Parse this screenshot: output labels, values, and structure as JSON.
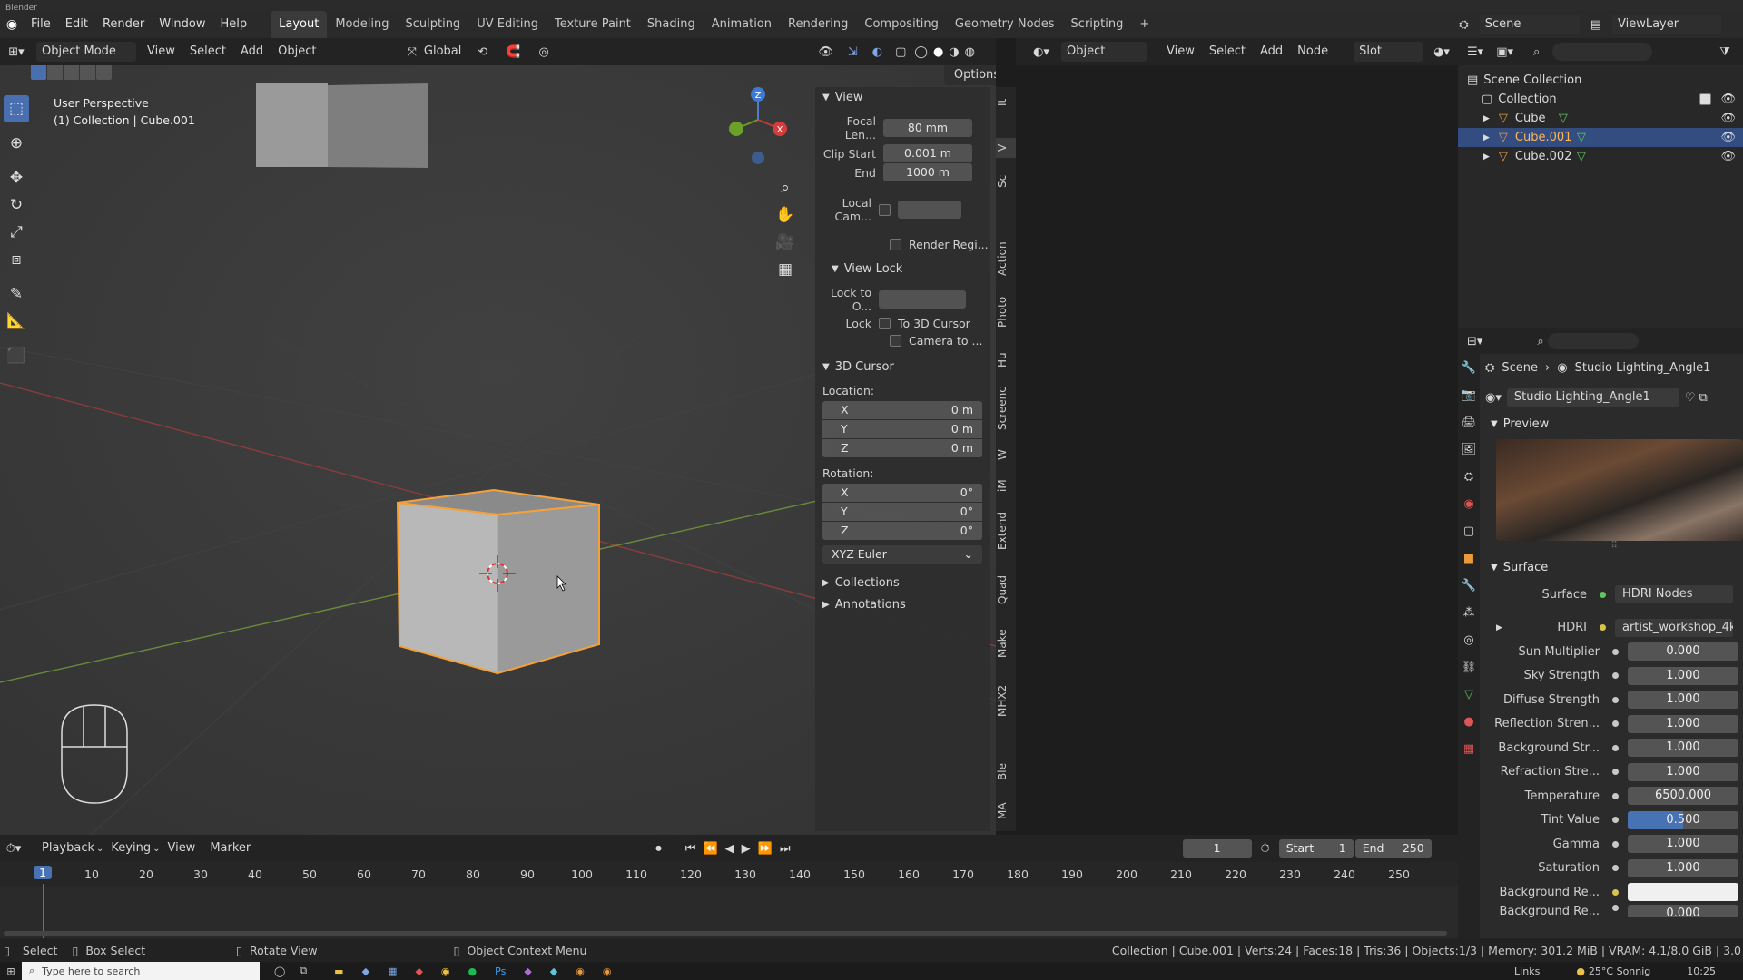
{
  "app": {
    "title": "Blender"
  },
  "menus": [
    "File",
    "Edit",
    "Render",
    "Window",
    "Help"
  ],
  "workspaces": [
    "Layout",
    "Modeling",
    "Sculpting",
    "UV Editing",
    "Texture Paint",
    "Shading",
    "Animation",
    "Rendering",
    "Compositing",
    "Geometry Nodes",
    "Scripting"
  ],
  "topright": {
    "scene": "Scene",
    "view_layer": "ViewLayer"
  },
  "vp_header": {
    "mode": "Object Mode",
    "view": "View",
    "select": "Select",
    "add": "Add",
    "object": "Object",
    "orientation": "Global",
    "options": "Options"
  },
  "viewport": {
    "perspective": "User Perspective",
    "collection": "(1) Collection | Cube.001"
  },
  "npanel": {
    "view_title": "View",
    "focal_label": "Focal Len...",
    "focal_value": "80 mm",
    "clip_start_label": "Clip Start",
    "clip_start_value": "0.001 m",
    "end_label": "End",
    "end_value": "1000 m",
    "local_cam_label": "Local Cam...",
    "render_region": "Render Regi...",
    "view_lock_title": "View Lock",
    "lock_to_label": "Lock to O...",
    "lock_label": "Lock",
    "to_3d_cursor": "To 3D Cursor",
    "camera_to": "Camera to ...",
    "cursor_title": "3D Cursor",
    "location_label": "Location:",
    "loc": [
      {
        "axis": "X",
        "value": "0 m"
      },
      {
        "axis": "Y",
        "value": "0 m"
      },
      {
        "axis": "Z",
        "value": "0 m"
      }
    ],
    "rotation_label": "Rotation:",
    "rot": [
      {
        "axis": "X",
        "value": "0°"
      },
      {
        "axis": "Y",
        "value": "0°"
      },
      {
        "axis": "Z",
        "value": "0°"
      }
    ],
    "rotation_mode": "XYZ Euler",
    "collections": "Collections",
    "annotations": "Annotations"
  },
  "panel_tabs": [
    "It",
    "V",
    "Sc",
    "Action",
    "Photo",
    "Hu",
    "Screenc",
    "W",
    "iM",
    "Extend",
    "Quad",
    "Make",
    "MHX2",
    "Ble",
    "MA"
  ],
  "node_header": {
    "object": "Object",
    "view": "View",
    "select": "Select",
    "add": "Add",
    "node": "Node",
    "slot": "Slot"
  },
  "outliner": {
    "scene_collection": "Scene Collection",
    "collection": "Collection",
    "items": [
      "Cube",
      "Cube.001",
      "Cube.002"
    ]
  },
  "props": {
    "breadcrumb_scene": "Scene",
    "breadcrumb_world": "Studio Lighting_Angle1",
    "world_name": "Studio Lighting_Angle1",
    "preview_title": "Preview",
    "surface_title": "Surface",
    "surface_label": "Surface",
    "surface_value": "HDRI Nodes",
    "hdri_label": "HDRI",
    "hdri_value": "artist_workshop_4k....",
    "rows": [
      {
        "label": "Sun Multiplier",
        "value": "0.000"
      },
      {
        "label": "Sky Strength",
        "value": "1.000"
      },
      {
        "label": "Diffuse Strength",
        "value": "1.000"
      },
      {
        "label": "Reflection Stren...",
        "value": "1.000"
      },
      {
        "label": "Background Str...",
        "value": "1.000"
      },
      {
        "label": "Refraction Stre...",
        "value": "1.000"
      },
      {
        "label": "Temperature",
        "value": "6500.000"
      },
      {
        "label": "Tint Value",
        "value": "0.500"
      },
      {
        "label": "Gamma",
        "value": "1.000"
      },
      {
        "label": "Saturation",
        "value": "1.000"
      }
    ],
    "bg_re_label": "Background Re...",
    "bg_re2_label": "Background Re...",
    "bg_re2_value": "0.000"
  },
  "timeline": {
    "playback": "Playback",
    "keying": "Keying",
    "view": "View",
    "marker": "Marker",
    "current_frame": "1",
    "start_label": "Start",
    "start_value": "1",
    "end_label": "End",
    "end_value": "250",
    "ticks": [
      "1",
      "10",
      "20",
      "30",
      "40",
      "50",
      "60",
      "70",
      "80",
      "90",
      "100",
      "110",
      "120",
      "130",
      "140",
      "150",
      "160",
      "170",
      "180",
      "190",
      "200",
      "210",
      "220",
      "230",
      "240",
      "250"
    ]
  },
  "status": {
    "select": "Select",
    "box_select": "Box Select",
    "rotate_view": "Rotate View",
    "context_menu": "Object Context Menu",
    "stats": "Collection | Cube.001 | Verts:24 | Faces:18 | Tris:36 | Objects:1/3 | Memory: 301.2 MiB | VRAM: 4.1/8.0 GiB | 3.0"
  },
  "taskbar": {
    "search_placeholder": "Type here to search",
    "links": "Links",
    "weather": "25°C Sonnig",
    "time": "10:25"
  }
}
